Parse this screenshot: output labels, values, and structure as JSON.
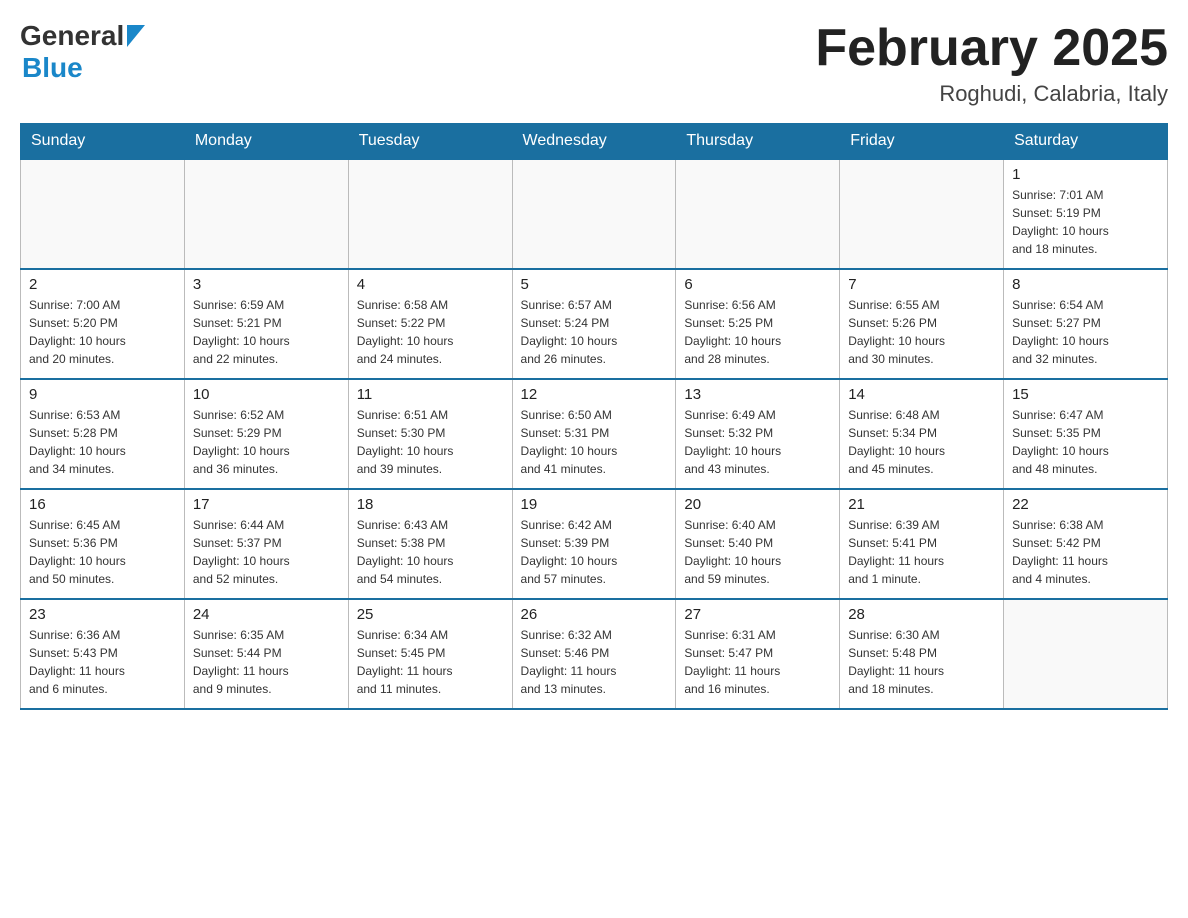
{
  "header": {
    "logo_general": "General",
    "logo_blue": "Blue",
    "month_title": "February 2025",
    "location": "Roghudi, Calabria, Italy"
  },
  "weekdays": [
    "Sunday",
    "Monday",
    "Tuesday",
    "Wednesday",
    "Thursday",
    "Friday",
    "Saturday"
  ],
  "weeks": [
    [
      {
        "day": "",
        "info": ""
      },
      {
        "day": "",
        "info": ""
      },
      {
        "day": "",
        "info": ""
      },
      {
        "day": "",
        "info": ""
      },
      {
        "day": "",
        "info": ""
      },
      {
        "day": "",
        "info": ""
      },
      {
        "day": "1",
        "info": "Sunrise: 7:01 AM\nSunset: 5:19 PM\nDaylight: 10 hours\nand 18 minutes."
      }
    ],
    [
      {
        "day": "2",
        "info": "Sunrise: 7:00 AM\nSunset: 5:20 PM\nDaylight: 10 hours\nand 20 minutes."
      },
      {
        "day": "3",
        "info": "Sunrise: 6:59 AM\nSunset: 5:21 PM\nDaylight: 10 hours\nand 22 minutes."
      },
      {
        "day": "4",
        "info": "Sunrise: 6:58 AM\nSunset: 5:22 PM\nDaylight: 10 hours\nand 24 minutes."
      },
      {
        "day": "5",
        "info": "Sunrise: 6:57 AM\nSunset: 5:24 PM\nDaylight: 10 hours\nand 26 minutes."
      },
      {
        "day": "6",
        "info": "Sunrise: 6:56 AM\nSunset: 5:25 PM\nDaylight: 10 hours\nand 28 minutes."
      },
      {
        "day": "7",
        "info": "Sunrise: 6:55 AM\nSunset: 5:26 PM\nDaylight: 10 hours\nand 30 minutes."
      },
      {
        "day": "8",
        "info": "Sunrise: 6:54 AM\nSunset: 5:27 PM\nDaylight: 10 hours\nand 32 minutes."
      }
    ],
    [
      {
        "day": "9",
        "info": "Sunrise: 6:53 AM\nSunset: 5:28 PM\nDaylight: 10 hours\nand 34 minutes."
      },
      {
        "day": "10",
        "info": "Sunrise: 6:52 AM\nSunset: 5:29 PM\nDaylight: 10 hours\nand 36 minutes."
      },
      {
        "day": "11",
        "info": "Sunrise: 6:51 AM\nSunset: 5:30 PM\nDaylight: 10 hours\nand 39 minutes."
      },
      {
        "day": "12",
        "info": "Sunrise: 6:50 AM\nSunset: 5:31 PM\nDaylight: 10 hours\nand 41 minutes."
      },
      {
        "day": "13",
        "info": "Sunrise: 6:49 AM\nSunset: 5:32 PM\nDaylight: 10 hours\nand 43 minutes."
      },
      {
        "day": "14",
        "info": "Sunrise: 6:48 AM\nSunset: 5:34 PM\nDaylight: 10 hours\nand 45 minutes."
      },
      {
        "day": "15",
        "info": "Sunrise: 6:47 AM\nSunset: 5:35 PM\nDaylight: 10 hours\nand 48 minutes."
      }
    ],
    [
      {
        "day": "16",
        "info": "Sunrise: 6:45 AM\nSunset: 5:36 PM\nDaylight: 10 hours\nand 50 minutes."
      },
      {
        "day": "17",
        "info": "Sunrise: 6:44 AM\nSunset: 5:37 PM\nDaylight: 10 hours\nand 52 minutes."
      },
      {
        "day": "18",
        "info": "Sunrise: 6:43 AM\nSunset: 5:38 PM\nDaylight: 10 hours\nand 54 minutes."
      },
      {
        "day": "19",
        "info": "Sunrise: 6:42 AM\nSunset: 5:39 PM\nDaylight: 10 hours\nand 57 minutes."
      },
      {
        "day": "20",
        "info": "Sunrise: 6:40 AM\nSunset: 5:40 PM\nDaylight: 10 hours\nand 59 minutes."
      },
      {
        "day": "21",
        "info": "Sunrise: 6:39 AM\nSunset: 5:41 PM\nDaylight: 11 hours\nand 1 minute."
      },
      {
        "day": "22",
        "info": "Sunrise: 6:38 AM\nSunset: 5:42 PM\nDaylight: 11 hours\nand 4 minutes."
      }
    ],
    [
      {
        "day": "23",
        "info": "Sunrise: 6:36 AM\nSunset: 5:43 PM\nDaylight: 11 hours\nand 6 minutes."
      },
      {
        "day": "24",
        "info": "Sunrise: 6:35 AM\nSunset: 5:44 PM\nDaylight: 11 hours\nand 9 minutes."
      },
      {
        "day": "25",
        "info": "Sunrise: 6:34 AM\nSunset: 5:45 PM\nDaylight: 11 hours\nand 11 minutes."
      },
      {
        "day": "26",
        "info": "Sunrise: 6:32 AM\nSunset: 5:46 PM\nDaylight: 11 hours\nand 13 minutes."
      },
      {
        "day": "27",
        "info": "Sunrise: 6:31 AM\nSunset: 5:47 PM\nDaylight: 11 hours\nand 16 minutes."
      },
      {
        "day": "28",
        "info": "Sunrise: 6:30 AM\nSunset: 5:48 PM\nDaylight: 11 hours\nand 18 minutes."
      },
      {
        "day": "",
        "info": ""
      }
    ]
  ]
}
